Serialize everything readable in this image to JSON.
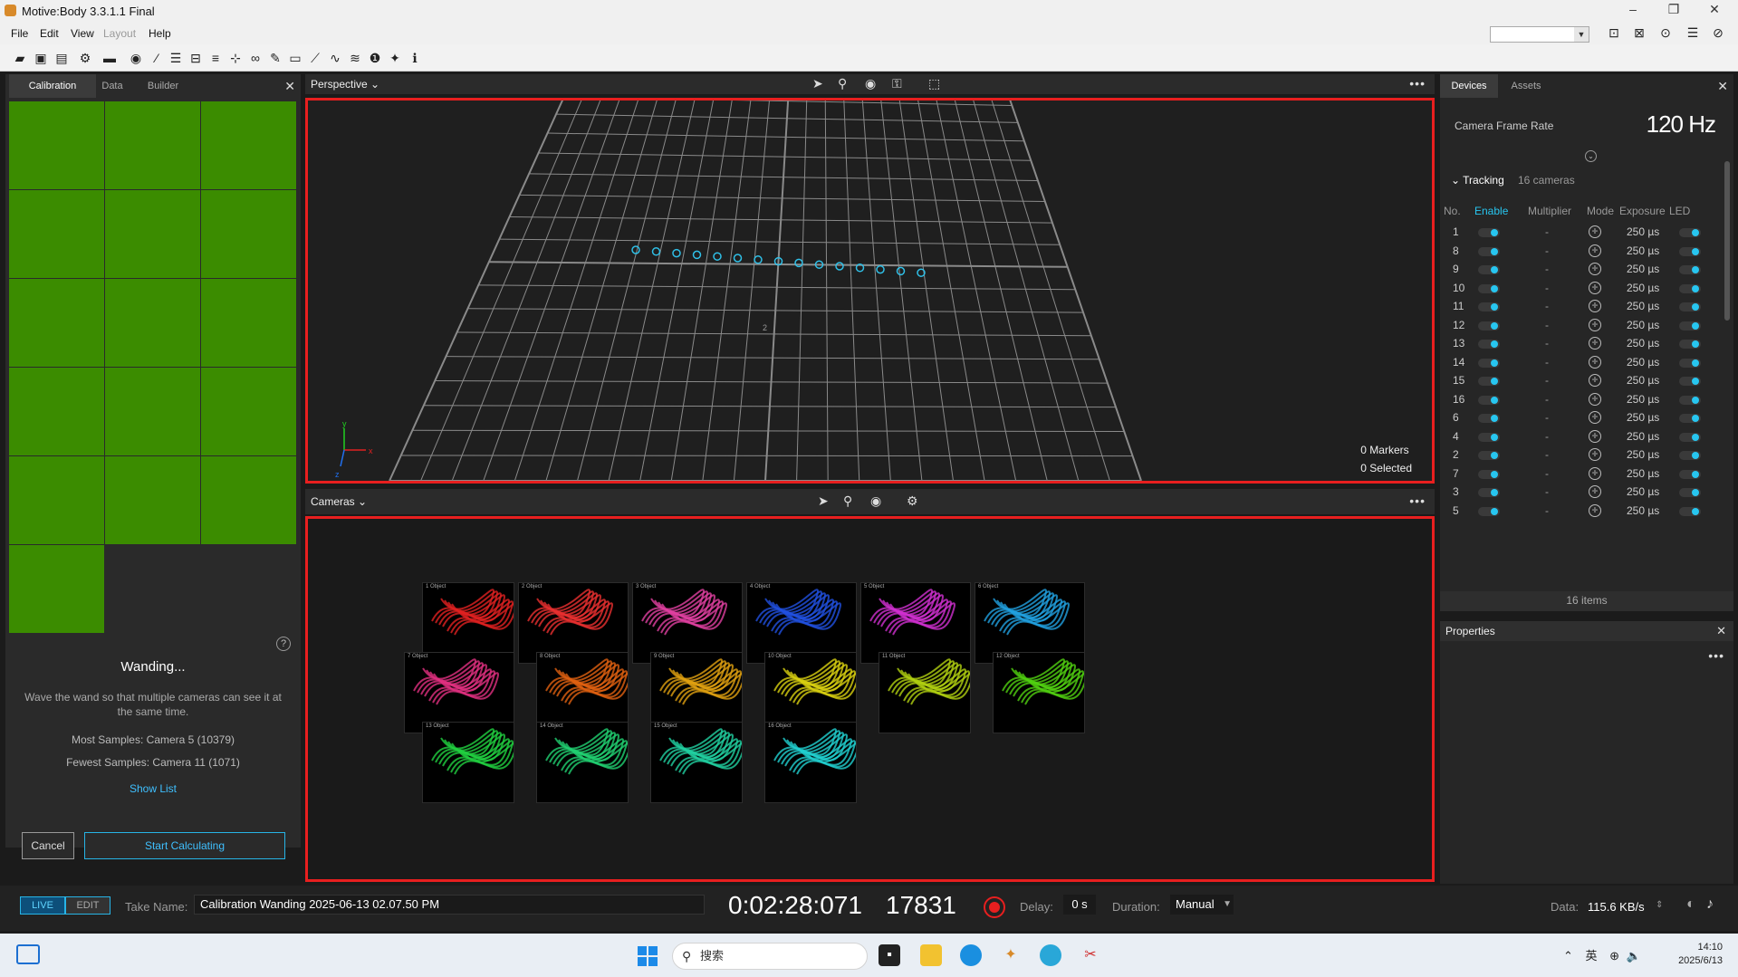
{
  "window": {
    "title": "Motive:Body 3.3.1.1 Final",
    "controls": [
      "–",
      "❐",
      "✕"
    ]
  },
  "menu": {
    "items": [
      "File",
      "Edit",
      "View",
      "Layout",
      "Help"
    ]
  },
  "left_panel": {
    "tabs": [
      "Calibration",
      "Data",
      "Builder"
    ],
    "close": "✕",
    "camera_grid_cells": 16,
    "status_title": "Wanding...",
    "description": "Wave the wand so that multiple cameras can see it at the same time.",
    "most_samples": "Most Samples: Camera 5 (10379)",
    "fewest_samples": "Fewest Samples: Camera 11 (1071)",
    "show_list": "Show List",
    "cancel": "Cancel",
    "start_calculating": "Start Calculating",
    "help": "?",
    "grid_color": "#3b8c00"
  },
  "perspective": {
    "title": "Perspective ⌄",
    "markers": "0 Markers",
    "selected": "0 Selected",
    "more": "•••",
    "axis_labels": {
      "y": "y",
      "x": "x",
      "z": "z"
    },
    "grid_label": "2"
  },
  "cameras_view": {
    "title": "Cameras ⌄",
    "more": "•••",
    "thumbnails": [
      {
        "label": "1  Object",
        "color": "#e02020"
      },
      {
        "label": "2  Object",
        "color": "#e83030"
      },
      {
        "label": "3  Object",
        "color": "#e040a0"
      },
      {
        "label": "4  Object",
        "color": "#2050e0"
      },
      {
        "label": "5  Object",
        "color": "#d030d0"
      },
      {
        "label": "6  Object",
        "color": "#20a0e0"
      },
      {
        "label": "7  Object",
        "color": "#e03080"
      },
      {
        "label": "8  Object",
        "color": "#e06010"
      },
      {
        "label": "9  Object",
        "color": "#e0a010"
      },
      {
        "label": "10  Object",
        "color": "#d8d010"
      },
      {
        "label": "11  Object",
        "color": "#b0d010"
      },
      {
        "label": "12  Object",
        "color": "#50d010"
      },
      {
        "label": "13  Object",
        "color": "#20d040"
      },
      {
        "label": "14  Object",
        "color": "#20d070"
      },
      {
        "label": "15  Object",
        "color": "#20d0a0"
      },
      {
        "label": "16  Object",
        "color": "#20d0d0"
      }
    ]
  },
  "right_panel": {
    "tabs": [
      "Devices",
      "Assets"
    ],
    "close": "✕",
    "frame_rate_label": "Camera Frame Rate",
    "frame_rate_value": "120 Hz",
    "collapse": "⌄",
    "tracking_label": "⌄  Tracking",
    "tracking_count": "16 cameras",
    "columns": [
      "No.",
      "Enable",
      "Multiplier",
      "Mode",
      "Exposure",
      "LED"
    ],
    "rows": [
      {
        "no": "1",
        "mult": "-",
        "exp": "250 µs"
      },
      {
        "no": "8",
        "mult": "-",
        "exp": "250 µs"
      },
      {
        "no": "9",
        "mult": "-",
        "exp": "250 µs"
      },
      {
        "no": "10",
        "mult": "-",
        "exp": "250 µs"
      },
      {
        "no": "11",
        "mult": "-",
        "exp": "250 µs"
      },
      {
        "no": "12",
        "mult": "-",
        "exp": "250 µs"
      },
      {
        "no": "13",
        "mult": "-",
        "exp": "250 µs"
      },
      {
        "no": "14",
        "mult": "-",
        "exp": "250 µs"
      },
      {
        "no": "15",
        "mult": "-",
        "exp": "250 µs"
      },
      {
        "no": "16",
        "mult": "-",
        "exp": "250 µs"
      },
      {
        "no": "6",
        "mult": "-",
        "exp": "250 µs"
      },
      {
        "no": "4",
        "mult": "-",
        "exp": "250 µs"
      },
      {
        "no": "2",
        "mult": "-",
        "exp": "250 µs"
      },
      {
        "no": "7",
        "mult": "-",
        "exp": "250 µs"
      },
      {
        "no": "3",
        "mult": "-",
        "exp": "250 µs"
      },
      {
        "no": "5",
        "mult": "-",
        "exp": "250 µs"
      }
    ],
    "items_count": "16 items",
    "accent": "#27c6f0"
  },
  "properties": {
    "title": "Properties",
    "close": "✕",
    "more": "•••"
  },
  "bottom_bar": {
    "live": "LIVE",
    "edit": "EDIT",
    "take_label": "Take Name:",
    "take_name": "Calibration Wanding 2025-06-13 02.07.50 PM",
    "timecode": "0:02:28:071",
    "frame": "17831",
    "delay_label": "Delay:",
    "delay_value": "0 s",
    "duration_label": "Duration:",
    "duration_value": "Manual",
    "data_label": "Data:",
    "data_value": "115.6 KB/s"
  },
  "taskbar": {
    "search_placeholder": "搜索",
    "tray_lang": "英",
    "time": "14:10",
    "date": "2025/6/13"
  }
}
